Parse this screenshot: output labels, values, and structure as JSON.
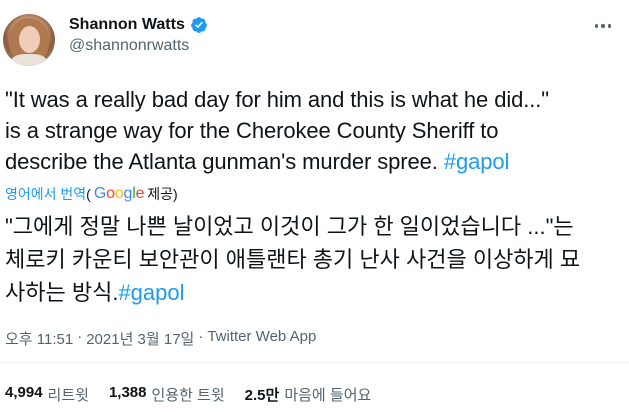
{
  "author": {
    "name": "Shannon Watts",
    "handle": "@shannonrwatts",
    "verified": true
  },
  "tweet": {
    "text_line1": "\"It was a really bad day for him and this is what he did...\"",
    "text_line2": "is a strange way for the Cherokee County Sheriff to",
    "text_line3": "describe the Atlanta gunman's murder spree. ",
    "hashtag": "#gapol"
  },
  "translation": {
    "link_label": "영어에서 번역",
    "open_paren": "(",
    "google_letters": [
      "G",
      "o",
      "o",
      "g",
      "l",
      "e"
    ],
    "provided_label": " 제공)",
    "text_line1": "\"그에게 정말 나쁜 날이었고 이것이 그가 한 일이었습니다 ...\"는",
    "text_line2": "체로키 카운티 보안관이 애틀랜타 총기 난사 사건을 이상하게 묘",
    "text_line3": "사하는 방식.",
    "hashtag": "#gapol"
  },
  "meta": {
    "time": "오후 11:51",
    "dot1": "·",
    "date": "2021년 3월 17일",
    "dot2": "·",
    "source": "Twitter Web App"
  },
  "stats": [
    {
      "num": "4,994",
      "label": "리트윗"
    },
    {
      "num": "1,388",
      "label": "인용한 트윗"
    },
    {
      "num": "2.5만",
      "label": "마음에 들어요"
    }
  ],
  "colors": {
    "accent": "#1d9bf0",
    "text": "#0f1419",
    "muted": "#536471"
  }
}
